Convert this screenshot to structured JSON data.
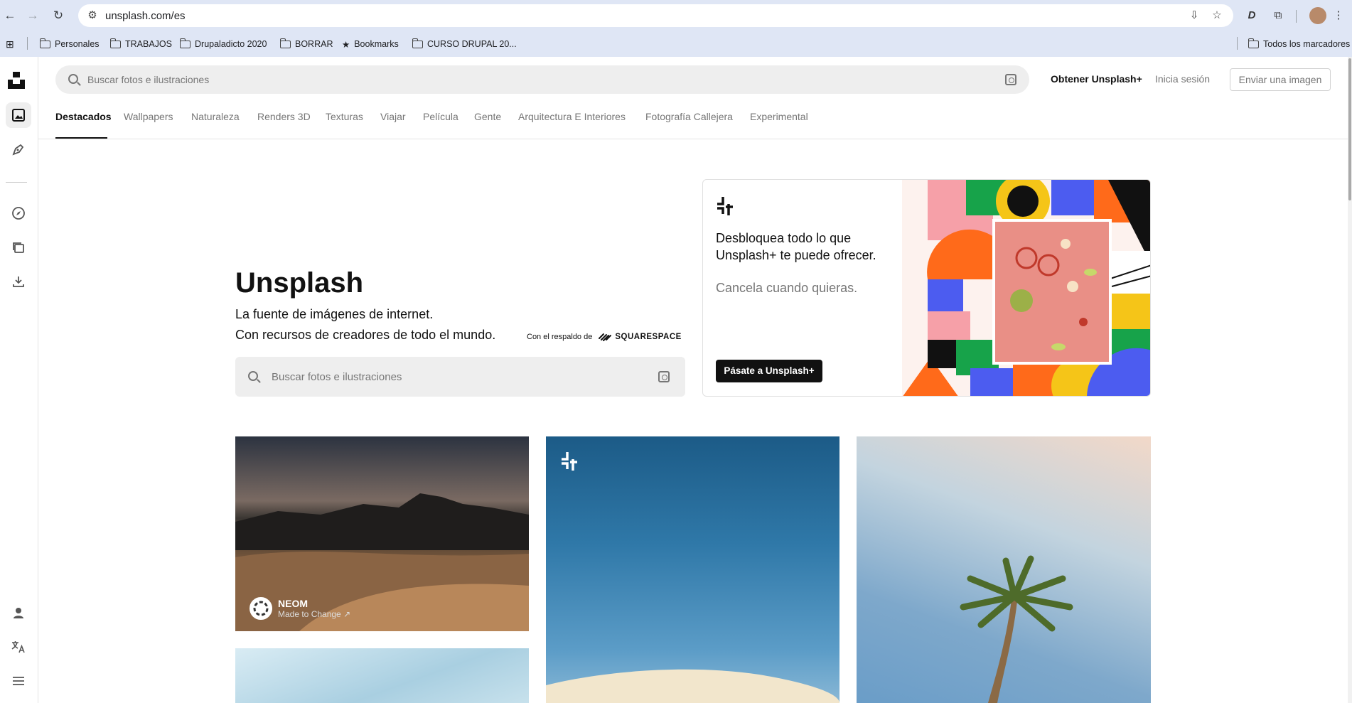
{
  "browser": {
    "url": "unsplash.com/es",
    "bookmarks": [
      "Personales",
      "TRABAJOS",
      "Drupaladicto 2020",
      "BORRAR",
      "Bookmarks",
      "CURSO DRUPAL 20...",
      "Todos los marcadores"
    ]
  },
  "header": {
    "search_placeholder": "Buscar fotos e ilustraciones",
    "get_plus": "Obtener Unsplash+",
    "login": "Inicia sesión",
    "submit": "Enviar una imagen"
  },
  "tabs": [
    "Destacados",
    "Wallpapers",
    "Naturaleza",
    "Renders 3D",
    "Texturas",
    "Viajar",
    "Película",
    "Gente",
    "Arquitectura E Interiores",
    "Fotografía Callejera",
    "Experimental"
  ],
  "hero": {
    "title": "Unsplash",
    "line1": "La fuente de imágenes de internet.",
    "line2": "Con recursos de creadores de todo el mundo.",
    "backed_by": "Con el respaldo de",
    "backer": "SQUARESPACE",
    "search_placeholder": "Buscar fotos e ilustraciones"
  },
  "promo": {
    "title": "Desbloquea todo lo que Unsplash+ te puede ofrecer.",
    "subtitle": "Cancela cuando quieras.",
    "button": "Pásate a Unsplash+"
  },
  "photos": {
    "first_credit_name": "NEOM",
    "first_credit_sub": "Made to Change ↗"
  },
  "colors": {
    "accent": "#111111",
    "muted": "#767676",
    "chrome": "#dfe6f5"
  }
}
